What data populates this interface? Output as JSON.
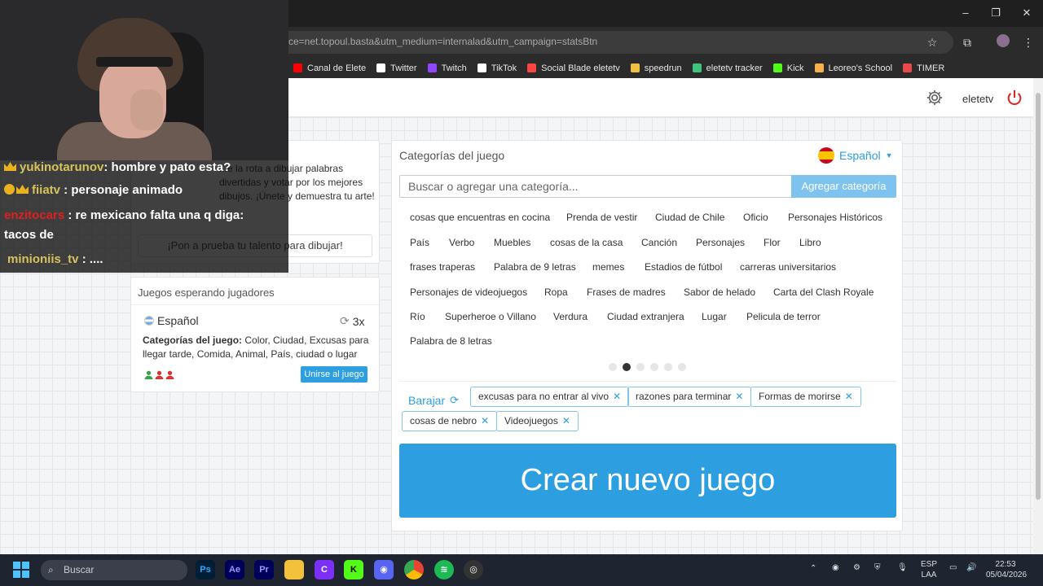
{
  "browser": {
    "url": "ce=net.topoul.basta&utm_medium=internalad&utm_campaign=statsBtn",
    "bookmarks": [
      {
        "label": "Canal de Elete",
        "color": "#ff0000"
      },
      {
        "label": "Twitter",
        "color": "#ffffff"
      },
      {
        "label": "Twitch",
        "color": "#9146ff"
      },
      {
        "label": "TikTok",
        "color": "#ffffff"
      },
      {
        "label": "Social Blade eletetv",
        "color": "#ff4444"
      },
      {
        "label": "speedrun",
        "color": "#f0c040"
      },
      {
        "label": "eletetv tracker",
        "color": "#3ec47c"
      },
      {
        "label": "Kick",
        "color": "#53fc18"
      },
      {
        "label": "Leoreo's School",
        "color": "#f8b04c"
      },
      {
        "label": "TIMER",
        "color": "#e84a4a"
      }
    ]
  },
  "appbar": {
    "username": "eletetv"
  },
  "promo": {
    "text": "...e la rota a dibujar palabras divertidas y votar por los mejores dibujos. ¡Únete y demuestra tu arte!",
    "button": "¡Pon a prueba tu talento para dibujar!"
  },
  "waiting": {
    "title": "Juegos esperando jugadores",
    "language": "Español",
    "rounds": "3x",
    "categories_label": "Categorías del juego:",
    "categories_value": "Color, Ciudad, Excusas para llegar tarde, Comida, Animal, País, ciudad o lugar",
    "join": "Unirse al juego"
  },
  "main": {
    "title": "Categorías del juego",
    "language": "Español",
    "search_placeholder": "Buscar o agregar una categoría...",
    "add_button": "Agregar categoría",
    "chips": [
      [
        "cosas que encuentras en cocina",
        "Prenda de vestir",
        "Ciudad de Chile",
        "Oficio",
        "Personajes Históricos"
      ],
      [
        "País",
        "Verbo",
        "Muebles",
        "cosas de la casa",
        "Canción",
        "Personajes",
        "Flor",
        "Libro"
      ],
      [
        "frases traperas",
        "Palabra de 9 letras",
        "memes",
        "Estadios de fútbol",
        "carreras universitarios"
      ],
      [
        "Personajes de videojuegos",
        "Ropa",
        "Frases de madres",
        "Sabor de helado",
        "Carta del Clash Royale"
      ],
      [
        "Río",
        "Superheroe o Villano",
        "Verdura",
        "Ciudad extranjera",
        "Lugar",
        "Pelicula de terror"
      ],
      [
        "Palabra de 8 letras"
      ]
    ],
    "pages": 6,
    "active_page": 2,
    "shuffle": "Barajar",
    "selected": [
      "excusas para no entrar al vivo",
      "razones para terminar",
      "Formas de morirse",
      "cosas de nebro",
      "Videojuegos"
    ],
    "create_button": "Crear nuevo juego"
  },
  "chat": {
    "lines": [
      {
        "user": "yukinotarunov",
        "msg": "hombre y pato esta?"
      },
      {
        "user": "fiiatv",
        "msg": "personaje animado"
      },
      {
        "user": "enzitocars",
        "msg": "re mexicano falta una q diga:"
      },
      {
        "user": "",
        "msg": "tacos de"
      },
      {
        "user": "minioniis_tv",
        "msg": "...."
      }
    ]
  },
  "taskbar": {
    "search": "Buscar",
    "lang": "ESP",
    "layout": "LAA",
    "time": "22:53",
    "date": "05/04/2026"
  }
}
